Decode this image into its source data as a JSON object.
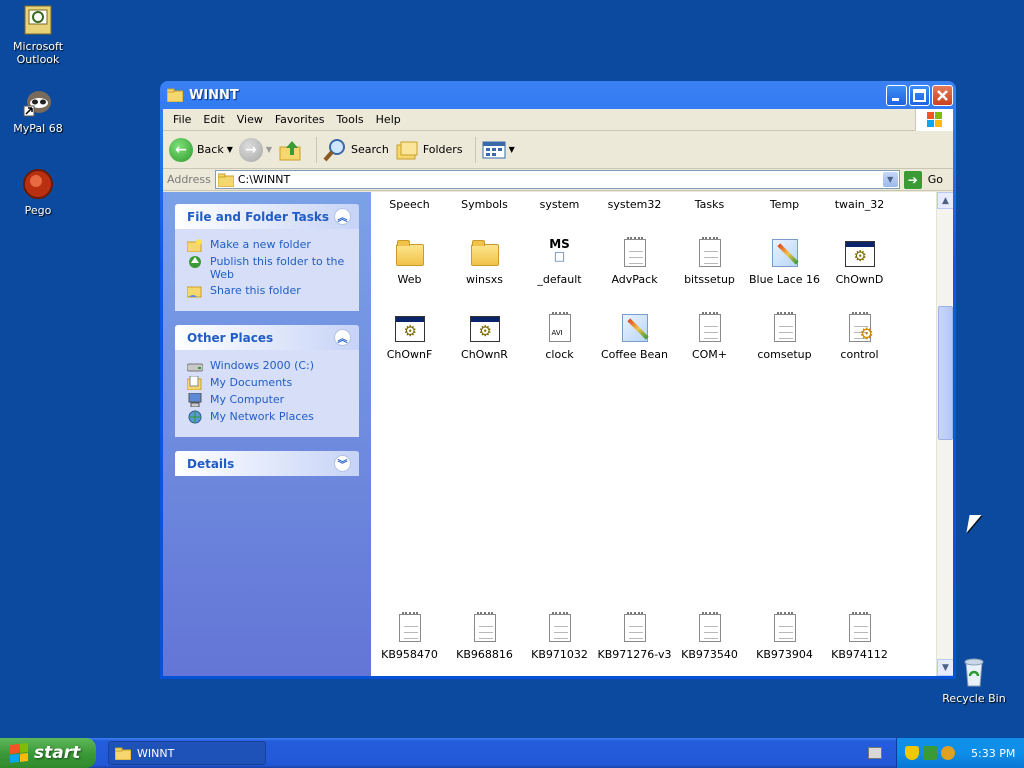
{
  "desktop": {
    "icons": [
      {
        "label": "Microsoft Outlook",
        "icon": "outlook-icon"
      },
      {
        "label": "MyPal 68",
        "icon": "raccoon-shortcut-icon"
      },
      {
        "label": "Pego",
        "icon": "pego-icon"
      },
      {
        "label": "Recycle Bin",
        "icon": "recycle-bin-icon"
      }
    ]
  },
  "window": {
    "title": "WINNT",
    "menu": [
      "File",
      "Edit",
      "View",
      "Favorites",
      "Tools",
      "Help"
    ],
    "toolbar": {
      "back_label": "Back",
      "search_label": "Search",
      "folders_label": "Folders"
    },
    "address": {
      "label": "Address",
      "value": "C:\\WINNT",
      "go_label": "Go"
    },
    "taskpane": {
      "file_tasks": {
        "title": "File and Folder Tasks",
        "links": [
          "Make a new folder",
          "Publish this folder to the Web",
          "Share this folder"
        ]
      },
      "other_places": {
        "title": "Other Places",
        "links": [
          "Windows 2000 (C:)",
          "My Documents",
          "My Computer",
          "My Network Places"
        ]
      },
      "details": {
        "title": "Details"
      }
    },
    "files": {
      "row0": [
        "Speech",
        "Symbols",
        "system",
        "system32",
        "Tasks",
        "Temp",
        "twain_32"
      ],
      "row1": [
        "Web",
        "winsxs",
        "_default",
        "AdvPack",
        "bitssetup",
        "Blue Lace 16",
        "ChOwnD"
      ],
      "row2": [
        "ChOwnF",
        "ChOwnR",
        "clock",
        "Coffee Bean",
        "COM+",
        "comsetup",
        "control"
      ],
      "row3": [
        "KB958470",
        "KB968816",
        "KB971032",
        "KB971276-v3",
        "KB973540",
        "KB973904",
        "KB974112"
      ]
    }
  },
  "taskbar": {
    "start_label": "start",
    "task_item": "WINNT",
    "clock": "5:33 PM"
  },
  "colors": {
    "desktop_bg": "#0b4a9e",
    "title_blue": "#0551d7",
    "taskpane_link": "#215dc6",
    "start_green": "#3c9a38"
  }
}
